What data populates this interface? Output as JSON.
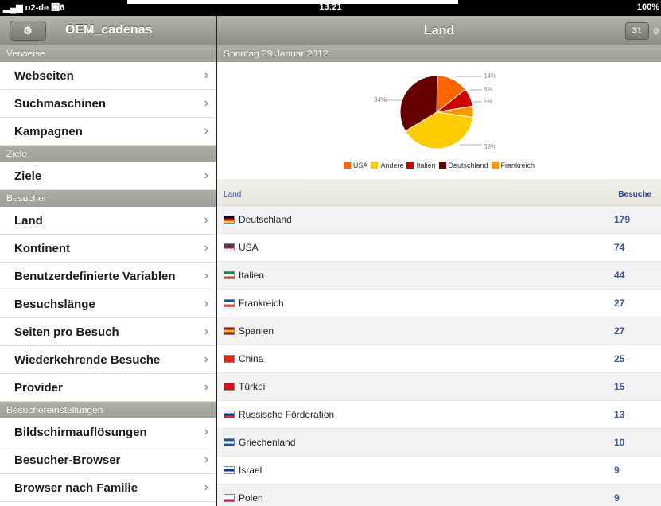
{
  "status": {
    "carrier": "▂▄▆ o2-de ὏6",
    "time": "13:21",
    "battery": "100%"
  },
  "left": {
    "tools_label": "Tl",
    "title": "OEM_cadenas",
    "sections": [
      {
        "header": "Verweise",
        "items": [
          "Webseiten",
          "Suchmaschinen",
          "Kampagnen"
        ]
      },
      {
        "header": "Ziele",
        "items": [
          "Ziele"
        ]
      },
      {
        "header": "Besucher",
        "items": [
          "Land",
          "Kontinent",
          "Benutzerdefinierte Variablen",
          "Besuchslänge",
          "Seiten pro Besuch",
          "Wiederkehrende Besuche",
          "Provider"
        ]
      },
      {
        "header": "Besuchereinstellungen",
        "items": [
          "Bildschirmauflösungen",
          "Besucher-Browser",
          "Browser nach Familie"
        ]
      }
    ],
    "chevron": "›"
  },
  "right": {
    "title": "Land",
    "calendar_label": "31",
    "date": "Sonntag 29 Januar 2012",
    "table": {
      "col_country": "Land",
      "col_visits": "Besuche",
      "rows": [
        {
          "country": "Deutschland",
          "visits": "179",
          "flag": [
            "#000000",
            "#dd0000",
            "#ffce00"
          ]
        },
        {
          "country": "USA",
          "visits": "74",
          "flag": [
            "#3c3b6e",
            "#b22234",
            "#ffffff"
          ]
        },
        {
          "country": "Italien",
          "visits": "44",
          "flag": [
            "#009246",
            "#ffffff",
            "#ce2b37"
          ]
        },
        {
          "country": "Frankreich",
          "visits": "27",
          "flag": [
            "#0055a4",
            "#ffffff",
            "#ef4135"
          ]
        },
        {
          "country": "Spanien",
          "visits": "27",
          "flag": [
            "#aa151b",
            "#f1bf00",
            "#aa151b"
          ]
        },
        {
          "country": "China",
          "visits": "25",
          "flag": [
            "#de2910",
            "#de2910",
            "#de2910"
          ]
        },
        {
          "country": "Türkei",
          "visits": "15",
          "flag": [
            "#e30a17",
            "#e30a17",
            "#e30a17"
          ]
        },
        {
          "country": "Russische Förderation",
          "visits": "13",
          "flag": [
            "#ffffff",
            "#0039a6",
            "#d52b1e"
          ]
        },
        {
          "country": "Griechenland",
          "visits": "10",
          "flag": [
            "#0d5eaf",
            "#ffffff",
            "#0d5eaf"
          ]
        },
        {
          "country": "Israel",
          "visits": "9",
          "flag": [
            "#ffffff",
            "#0038b8",
            "#ffffff"
          ]
        },
        {
          "country": "Polen",
          "visits": "9",
          "flag": [
            "#ffffff",
            "#ffffff",
            "#dc143c"
          ]
        }
      ]
    }
  },
  "chart_data": {
    "type": "pie",
    "slices": [
      {
        "name": "USA",
        "value": 14,
        "label": "14%",
        "color": "#ff6600"
      },
      {
        "name": "Italien",
        "value": 8,
        "label": "8%",
        "color": "#cc0000"
      },
      {
        "name": "Frankreich",
        "value": 5,
        "label": "5%",
        "color": "#ff9900"
      },
      {
        "name": "Andere",
        "value": 39,
        "label": "39%",
        "color": "#ffcc00"
      },
      {
        "name": "Deutschland",
        "value": 34,
        "label": "34%",
        "color": "#660000"
      }
    ],
    "legend": [
      "USA",
      "Andere",
      "Italien",
      "Deutschland",
      "Frankreich"
    ],
    "legend_colors": [
      "#ff6600",
      "#ffcc00",
      "#cc0000",
      "#660000",
      "#ff9900"
    ]
  }
}
